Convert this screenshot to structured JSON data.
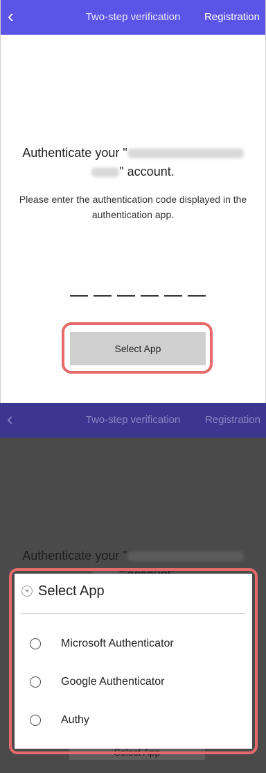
{
  "screen1": {
    "app_bar": {
      "back_icon": "chevron-left-icon",
      "title": "Two-step verification",
      "registration": "Registration"
    },
    "auth_prefix": "Authenticate your \"",
    "auth_suffix": "\" account.",
    "instructions": "Please enter the authentication code displayed in the authentication app.",
    "select_app_button": "Select App"
  },
  "screen2": {
    "app_bar": {
      "back_icon": "chevron-left-icon",
      "title": "Two-step verification",
      "registration": "Registration"
    },
    "auth_prefix": "Authenticate your \"",
    "auth_suffix": "\" account.",
    "select_app_button": "Select App",
    "sheet": {
      "title": "Select App",
      "options": [
        "Microsoft Authenticator",
        "Google Authenticator",
        "Authy"
      ]
    }
  },
  "colors": {
    "app_bar": "#5b54e6",
    "highlight": "#e66a6a",
    "overlay": "#4a4a4a"
  }
}
